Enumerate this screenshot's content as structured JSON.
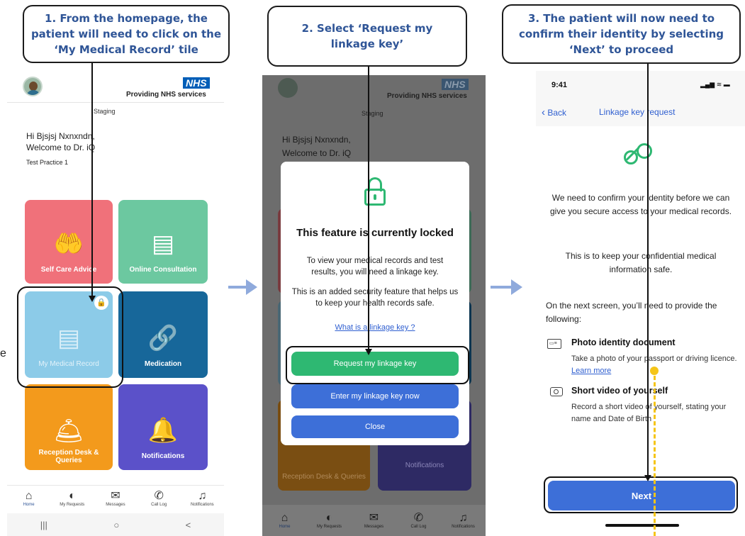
{
  "callouts": {
    "step1": "1. From the homepage, the patient will need to click on the ‘My Medical Record’ tile",
    "step2": "2. Select ‘Request my linkage key’",
    "step3": "3. The patient will now need to confirm their identity by selecting ‘Next’ to proceed"
  },
  "home": {
    "nhs_logo": "NHS",
    "nhs_tagline": "Providing NHS services",
    "env": "Staging",
    "greeting": "Hi Bjsjsj Nxnxndn,",
    "welcome": "Welcome to Dr. iQ",
    "practice": "Test Practice 1",
    "tiles": [
      {
        "label": "Self Care Advice",
        "color": "#f0717a"
      },
      {
        "label": "Online Consultation",
        "color": "#6cc8a0"
      },
      {
        "label": "My Medical Record",
        "color": "#8ccbe8"
      },
      {
        "label": "Medication",
        "color": "#17679a"
      },
      {
        "label": "Reception Desk & Queries",
        "color": "#f39a1c"
      },
      {
        "label": "Notifications",
        "color": "#5b51c9"
      }
    ],
    "nav": [
      "Home",
      "My Requests",
      "Messages",
      "Call Log",
      "Notifications"
    ],
    "sysnav": [
      "|||",
      "○",
      "<"
    ]
  },
  "modal": {
    "title": "This feature is currently locked",
    "body1": "To view your medical records and test results, you will need a linkage key.",
    "body2": "This is an added security feature that helps us to keep your health records safe.",
    "link": "What is a linkage key ?",
    "btn_request": "Request my linkage key",
    "btn_enter": "Enter my linkage key now",
    "btn_close": "Close"
  },
  "ios": {
    "time": "9:41",
    "status_icons": "▂▄▆ ≋ ▬",
    "back": "Back",
    "title": "Linkage key request",
    "para1": "We need to confirm your identity before we can give you secure access to your medical records.",
    "para2": "This is to keep your confidential medical information safe.",
    "para3": "On the next screen, you’ll need to provide the following:",
    "item1_title": "Photo identity document",
    "item1_desc": "Take a photo of your passport or driving licence.",
    "item1_link": "Learn more",
    "item2_title": "Short video of yourself",
    "item2_desc": "Record a short video of yourself, stating your name and Date of Birth",
    "next": "Next"
  },
  "margin_text": "e",
  "colors": {
    "accent_blue": "#2f5597",
    "green": "#2eb872",
    "blue_btn": "#3d6fd8",
    "yellow": "#f5c518"
  }
}
